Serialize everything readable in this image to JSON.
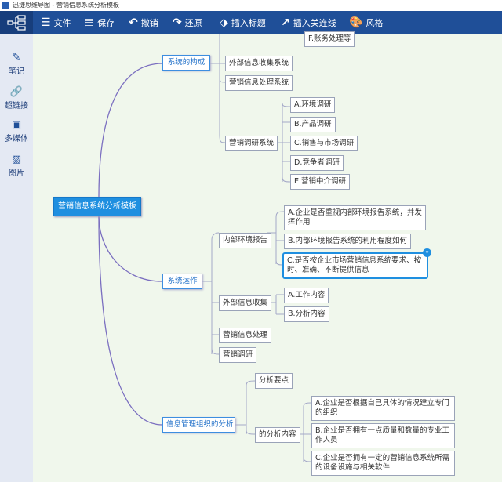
{
  "window": {
    "title": "迅捷思维导图 - 营销信息系统分析模板"
  },
  "toolbar": {
    "file": "文件",
    "save": "保存",
    "undo": "撤销",
    "redo": "还原",
    "insert_topic": "插入标题",
    "insert_relation": "插入关连线",
    "style": "风格"
  },
  "sidebar": {
    "items": [
      {
        "label": "笔记",
        "icon": "pen-icon"
      },
      {
        "label": "超链接",
        "icon": "link-icon"
      },
      {
        "label": "多媒体",
        "icon": "media-icon"
      },
      {
        "label": "图片",
        "icon": "image-icon"
      }
    ]
  },
  "colors": {
    "accent": "#1f8fe0",
    "toolbar": "#1f4f98",
    "canvas": "#f0f7ec"
  },
  "map": {
    "root": "营销信息系统分析模板",
    "b1": {
      "label": "系统的构成",
      "c1": "外部信息收集系统",
      "c2": "营销信息处理系统",
      "c3": "营销调研系统",
      "f": "F.账务处理等",
      "research": [
        "A.环境调研",
        "B.产品调研",
        "C.销售与市场调研",
        "D.竞争者调研",
        "E.营销中介调研"
      ]
    },
    "b2": {
      "label": "系统运作",
      "c1": "内部环境报告",
      "c1_items": [
        "A.企业是否重视内部环境报告系统，并发挥作用",
        "B.内部环境报告系统的利用程度如何",
        "C.是否按企业市场营销信息系统要求、按时、准确、不断提供信息"
      ],
      "c2": "外部信息收集",
      "c2_items": [
        "A.工作内容",
        "B.分析内容"
      ],
      "c3": "营销信息处理",
      "c4": "营销调研"
    },
    "b3": {
      "label": "信息管理组织的分析",
      "c1": "分析要点",
      "c2": "的分析内容",
      "c2_items": [
        "A.企业是否根据自己具体的情况建立专门的组织",
        "B.企业是否拥有一点质量和数量的专业工作人员",
        "C.企业是否拥有一定的营销信息系统所需的设备设施与相关软件"
      ]
    }
  }
}
